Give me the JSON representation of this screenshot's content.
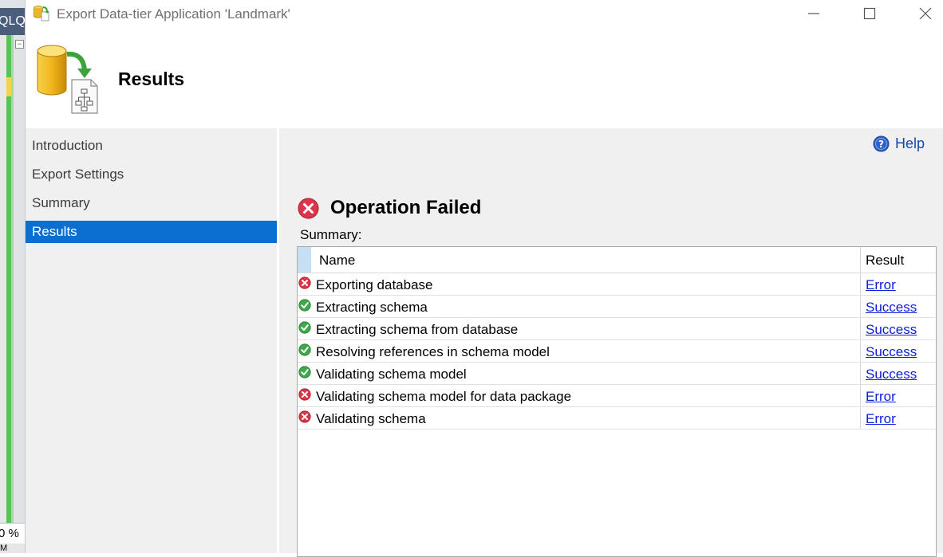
{
  "background_app": {
    "tab_label": "QLQ",
    "zoom_label": "0 %",
    "bottom_label": "M"
  },
  "window": {
    "title": "Export Data-tier Application 'Landmark'",
    "header_title": "Results"
  },
  "nav": {
    "items": [
      {
        "label": "Introduction",
        "selected": false
      },
      {
        "label": "Export Settings",
        "selected": false
      },
      {
        "label": "Summary",
        "selected": false
      },
      {
        "label": "Results",
        "selected": true
      }
    ]
  },
  "main": {
    "help_label": "Help",
    "status_text": "Operation Failed",
    "summary_label": "Summary:",
    "columns": {
      "name": "Name",
      "result": "Result"
    },
    "rows": [
      {
        "name": "Exporting database",
        "result": "Error",
        "status": "error"
      },
      {
        "name": "Extracting schema",
        "result": "Success",
        "status": "success"
      },
      {
        "name": "Extracting schema from database",
        "result": "Success",
        "status": "success"
      },
      {
        "name": "Resolving references in schema model",
        "result": "Success",
        "status": "success"
      },
      {
        "name": "Validating schema model",
        "result": "Success",
        "status": "success"
      },
      {
        "name": "Validating schema model for data package",
        "result": "Error",
        "status": "error"
      },
      {
        "name": "Validating schema",
        "result": "Error",
        "status": "error"
      }
    ]
  },
  "colors": {
    "selection": "#0a6fd1",
    "error": "#d9364a",
    "success": "#3fa84a",
    "link": "#0b1fd8",
    "help": "#1a46a8"
  },
  "icons": {
    "title": "database-export-icon",
    "header": "database-to-package-icon",
    "help": "help-question-icon",
    "status": "error-circle-icon",
    "row_error": "error-circle-icon",
    "row_success": "check-circle-icon"
  }
}
